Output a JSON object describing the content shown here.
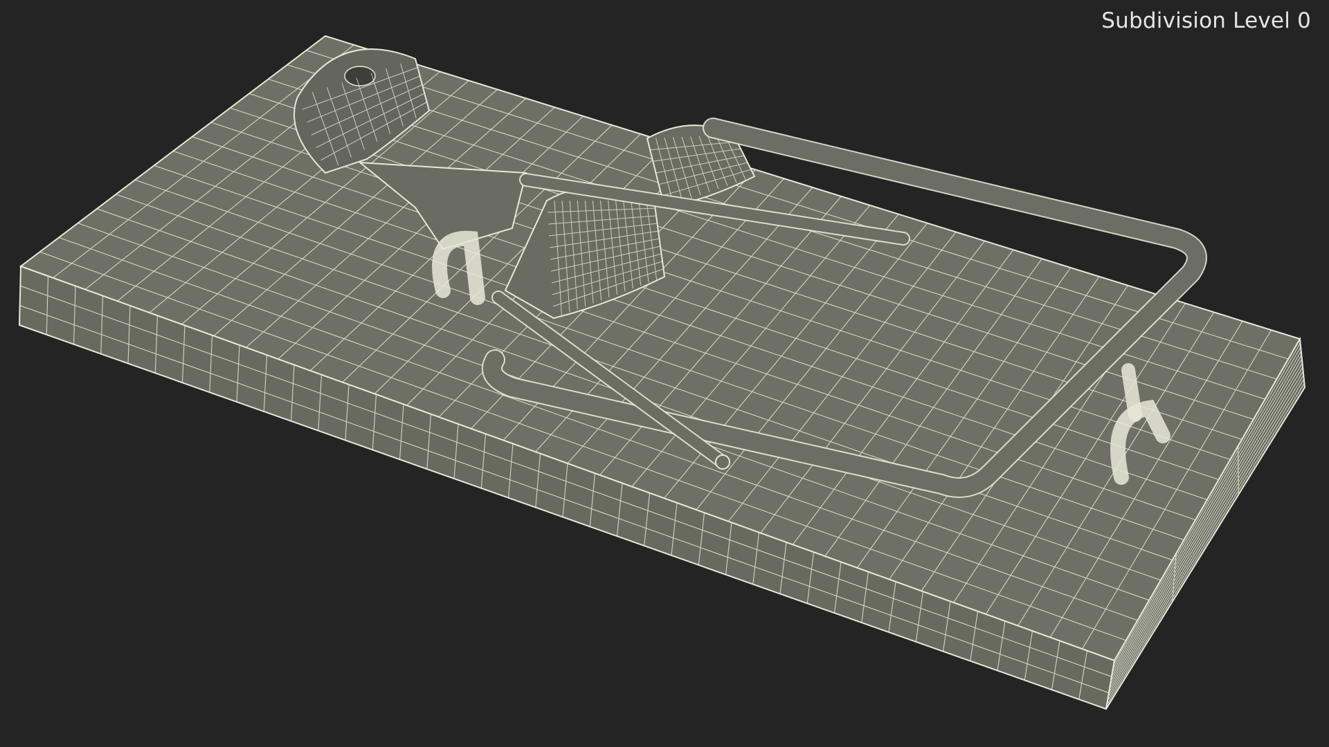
{
  "overlay": {
    "subdivision_label": "Subdivision Level 0"
  },
  "colors": {
    "background": "#242424",
    "surface": "#6e7066",
    "surface_light": "#7b7d72",
    "surface_dark": "#5c5e55",
    "wire": "#e8e8d8"
  }
}
